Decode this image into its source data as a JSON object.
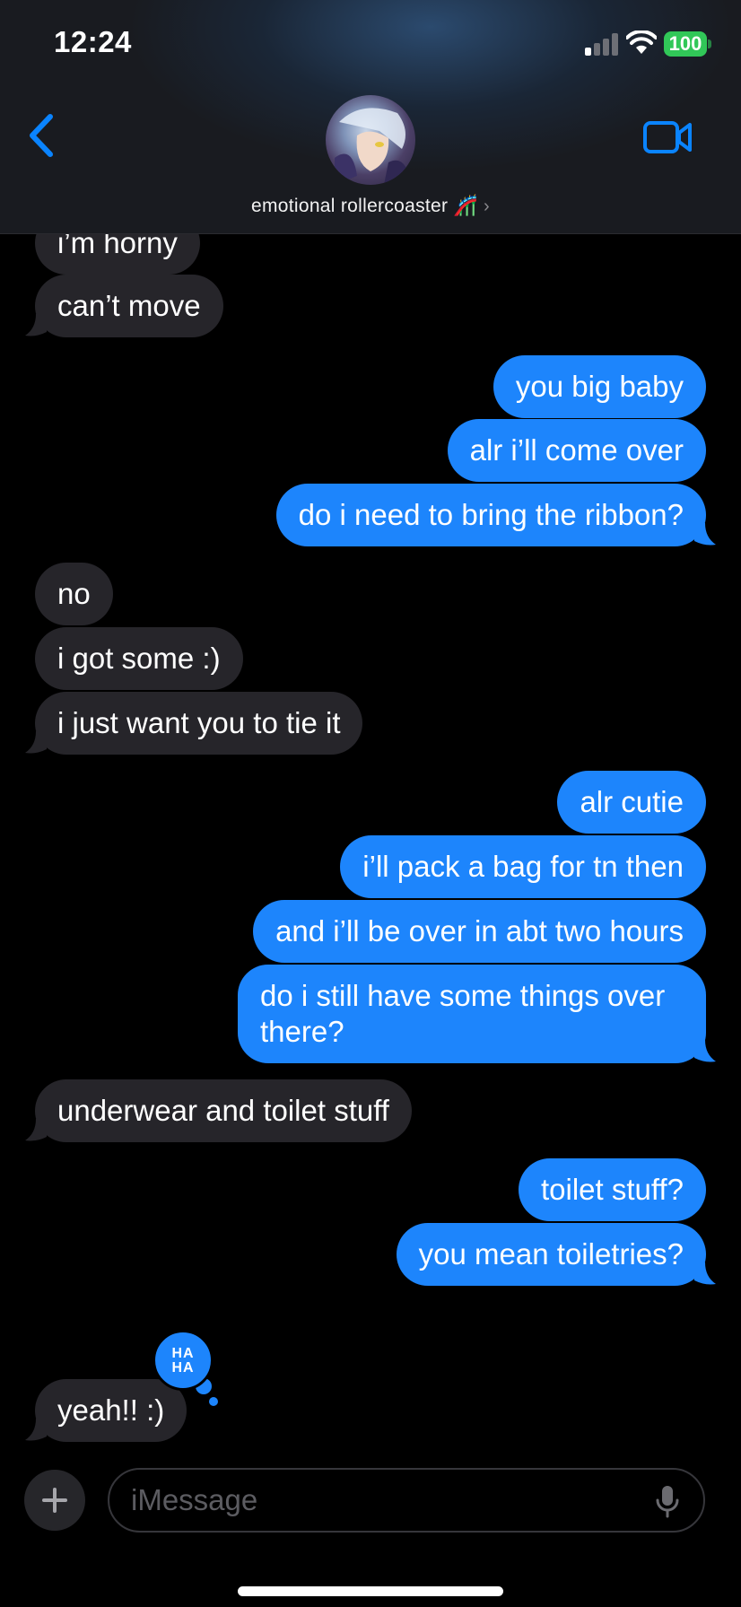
{
  "status_bar": {
    "time": "12:24",
    "battery": "100"
  },
  "header": {
    "contact_name": "emotional rollercoaster",
    "contact_emoji": "🎢"
  },
  "messages": [
    {
      "from": "them",
      "text": "i’m horny"
    },
    {
      "from": "them",
      "text": "can’t move"
    },
    {
      "from": "me",
      "text": "you big baby"
    },
    {
      "from": "me",
      "text": "alr i’ll come over"
    },
    {
      "from": "me",
      "text": "do i need to bring the ribbon?"
    },
    {
      "from": "them",
      "text": "no"
    },
    {
      "from": "them",
      "text": "i got some :)"
    },
    {
      "from": "them",
      "text": "i just want you to tie it"
    },
    {
      "from": "me",
      "text": "alr cutie"
    },
    {
      "from": "me",
      "text": "i’ll pack a bag for tn then"
    },
    {
      "from": "me",
      "text": "and i’ll be over in abt two hours"
    },
    {
      "from": "me",
      "text": "do i still have some things over there?"
    },
    {
      "from": "them",
      "text": "underwear and toilet stuff"
    },
    {
      "from": "me",
      "text": "toilet stuff?"
    },
    {
      "from": "me",
      "text": "you mean toiletries?"
    },
    {
      "from": "them",
      "text": "yeah!! :)"
    }
  ],
  "tapback": {
    "line1": "HA",
    "line2": "HA"
  },
  "composer": {
    "placeholder": "iMessage"
  },
  "colors": {
    "sent_bubble": "#1d85fc",
    "received_bubble": "#26252a",
    "accent": "#0a84ff",
    "battery": "#31c758"
  }
}
